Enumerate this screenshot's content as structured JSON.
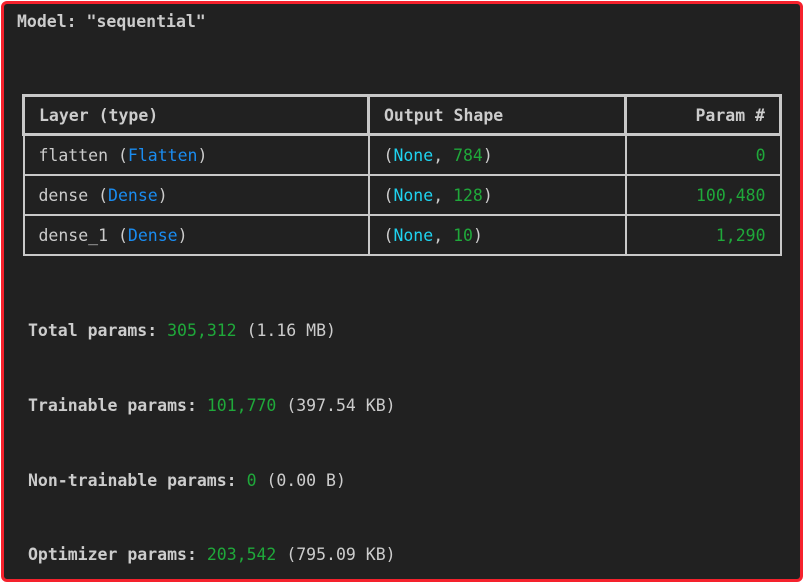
{
  "model_title": "Model: \"sequential\"",
  "table": {
    "headers": [
      "Layer (type)",
      "Output Shape",
      "Param #"
    ],
    "rows": [
      {
        "name": "flatten",
        "type": "Flatten",
        "shape_none": "None",
        "shape_dim": "784",
        "params": "0"
      },
      {
        "name": "dense",
        "type": "Dense",
        "shape_none": "None",
        "shape_dim": "128",
        "params": "100,480"
      },
      {
        "name": "dense_1",
        "type": "Dense",
        "shape_none": "None",
        "shape_dim": "10",
        "params": "1,290"
      }
    ]
  },
  "summary": [
    {
      "label": "Total params:",
      "value": "305,312",
      "size": "(1.16 MB)"
    },
    {
      "label": "Trainable params:",
      "value": "101,770",
      "size": "(397.54 KB)"
    },
    {
      "label": "Non-trainable params:",
      "value": "0",
      "size": "(0.00 B)"
    },
    {
      "label": "Optimizer params:",
      "value": "203,542",
      "size": "(795.09 KB)"
    }
  ],
  "colors": {
    "background": "#212121",
    "border": "#f5222d",
    "type": "#1a8cf0",
    "none": "#1ed3f0",
    "number": "#1fa83a"
  }
}
